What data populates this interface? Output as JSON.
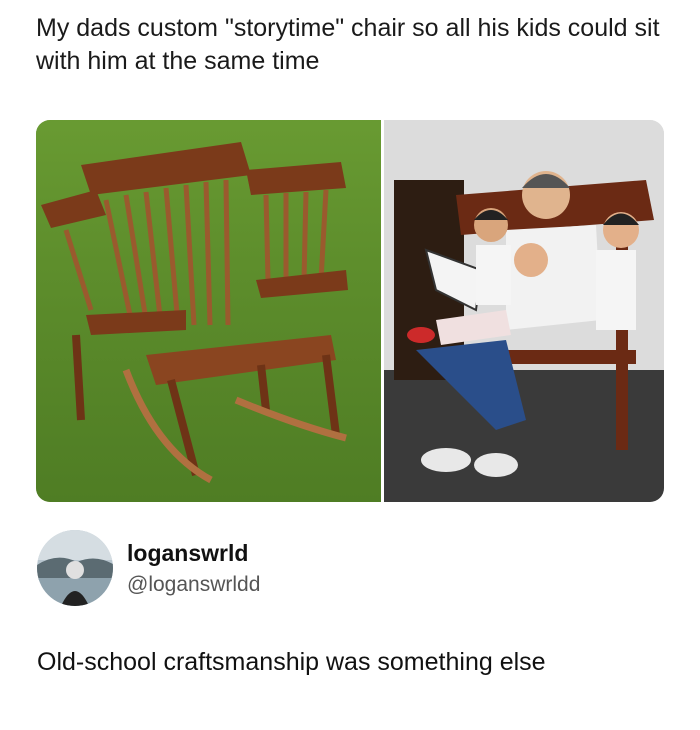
{
  "post": {
    "caption": "My dads custom \"storytime\" chair so all his kids could sit with him at the same time",
    "image_alt_icons": [
      "rocking-chair-photo",
      "family-reading-photo"
    ]
  },
  "tweet": {
    "display_name": "loganswrld",
    "handle": "@loganswrldd",
    "text": "Old-school craftsmanship was something else"
  },
  "colors": {
    "grass": "#5d8f2a",
    "wood": "#7a3b1c",
    "text": "#111111",
    "handle": "#555555"
  }
}
